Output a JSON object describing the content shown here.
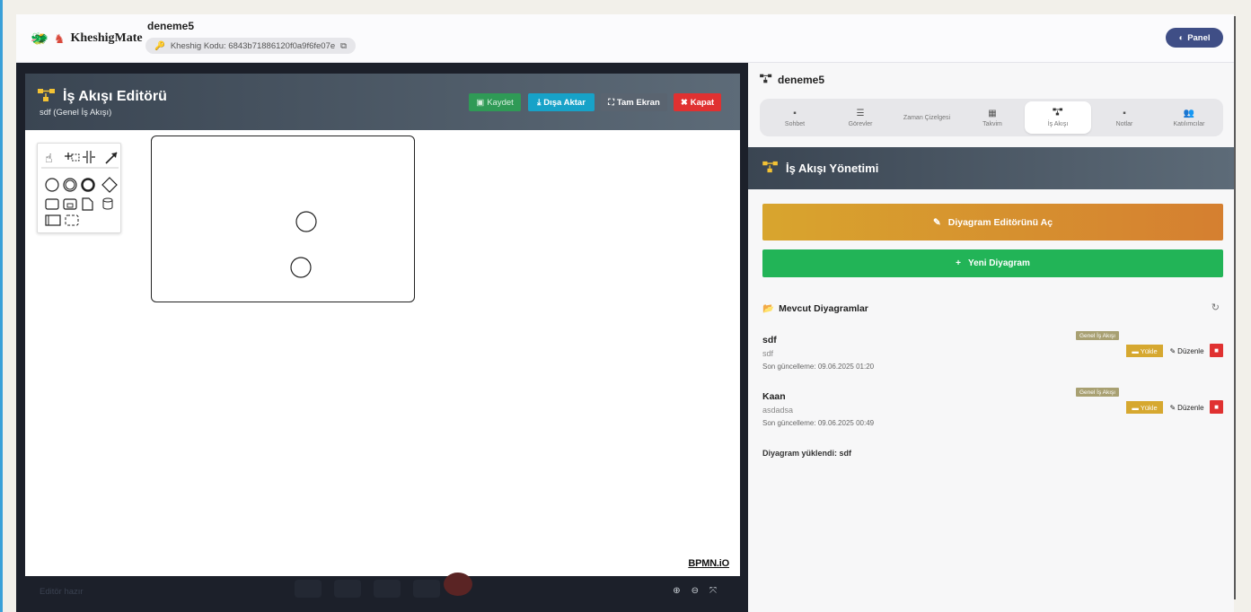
{
  "app": {
    "brand": "KheshigMate",
    "room_title": "deneme5",
    "code_label": "Kheshig Kodu: 6843b71886120f0a9f6fe07e",
    "panel_button": "Panel"
  },
  "editor": {
    "title": "İş Akışı Editörü",
    "subtitle": "sdf (Genel İş Akışı)",
    "buttons": {
      "save": "Kaydet",
      "export": "Dışa Aktar",
      "fullscreen": "Tam Ekran",
      "close": "Kapat"
    },
    "watermark": "BPMN.iO",
    "status": "Editör hazır"
  },
  "right_panel": {
    "title": "deneme5",
    "tabs": [
      {
        "label": "Sohbet",
        "icon": "chat-icon"
      },
      {
        "label": "Görevler",
        "icon": "tasks-icon"
      },
      {
        "label": "Zaman Çizelgesi",
        "icon": "timeline-icon"
      },
      {
        "label": "Takvim",
        "icon": "calendar-icon"
      },
      {
        "label": "İş Akışı",
        "icon": "workflow-icon",
        "active": true
      },
      {
        "label": "Notlar",
        "icon": "notes-icon"
      },
      {
        "label": "Katılımcılar",
        "icon": "participants-icon"
      }
    ],
    "workflow_header": "İş Akışı Yönetimi",
    "open_editor_button": "Diyagram Editörünü Aç",
    "new_diagram_button": "Yeni Diyagram",
    "existing_title": "Mevcut Diyagramlar",
    "diagrams": [
      {
        "name": "sdf",
        "description": "sdf",
        "updated": "Son güncelleme: 09.06.2025 01:20",
        "tag": "Genel İş Akışı",
        "load": "Yükle",
        "edit": "Düzenle"
      },
      {
        "name": "Kaan",
        "description": "asdadsa",
        "updated": "Son güncelleme: 09.06.2025 00:49",
        "tag": "Genel İş Akışı",
        "load": "Yükle",
        "edit": "Düzenle"
      }
    ],
    "loaded_message": "Diyagram yüklendi: sdf"
  },
  "colors": {
    "accent": "#3f4e86",
    "save": "#2f9a56",
    "export": "#17a2c8",
    "close": "#e03131",
    "open_editor": "#d8a52e",
    "new_diagram": "#22b457"
  }
}
